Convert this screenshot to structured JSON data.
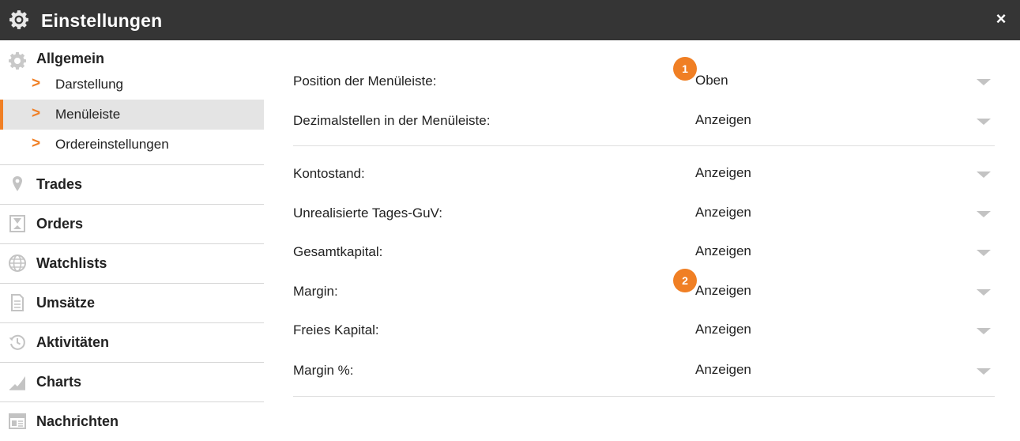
{
  "window": {
    "title": "Einstellungen",
    "close_glyph": "×",
    "icon": "gear-icon"
  },
  "sidebar": {
    "allgemein": {
      "label": "Allgemein",
      "icon": "gear-icon",
      "items": [
        {
          "label": "Darstellung",
          "active": false
        },
        {
          "label": "Menüleiste",
          "active": true
        },
        {
          "label": "Ordereinstellungen",
          "active": false
        }
      ]
    },
    "sections": [
      {
        "label": "Trades",
        "icon": "map-pin-icon"
      },
      {
        "label": "Orders",
        "icon": "hourglass-icon"
      },
      {
        "label": "Watchlists",
        "icon": "globe-icon"
      },
      {
        "label": "Umsätze",
        "icon": "document-icon"
      },
      {
        "label": "Aktivitäten",
        "icon": "history-icon"
      },
      {
        "label": "Charts",
        "icon": "area-chart-icon"
      },
      {
        "label": "Nachrichten",
        "icon": "newspaper-icon"
      }
    ],
    "arrow_glyph": ">"
  },
  "settings": {
    "group1": [
      {
        "label": "Position der Menüleiste:",
        "value": "Oben"
      },
      {
        "label": "Dezimalstellen in der Menüleiste:",
        "value": "Anzeigen"
      }
    ],
    "group2": [
      {
        "label": "Kontostand:",
        "value": "Anzeigen"
      },
      {
        "label": "Unrealisierte Tages-GuV:",
        "value": "Anzeigen"
      },
      {
        "label": "Gesamtkapital:",
        "value": "Anzeigen"
      },
      {
        "label": "Margin:",
        "value": "Anzeigen"
      },
      {
        "label": "Freies Kapital:",
        "value": "Anzeigen"
      },
      {
        "label": "Margin %:",
        "value": "Anzeigen"
      }
    ]
  },
  "badges": [
    {
      "text": "1"
    },
    {
      "text": "2"
    }
  ],
  "colors": {
    "accent": "#f07f24",
    "titlebar": "#353535",
    "active_bg": "#e4e4e4"
  }
}
